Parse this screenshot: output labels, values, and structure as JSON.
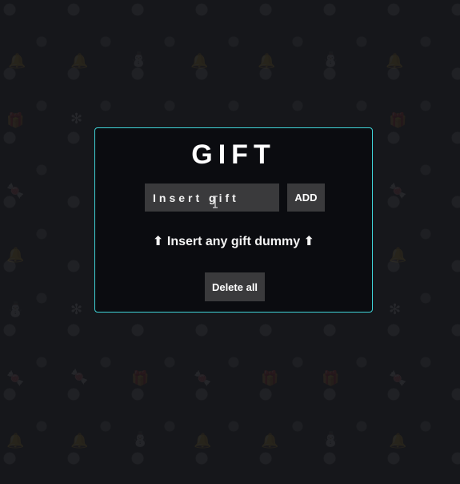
{
  "app": {
    "title": "GIFT"
  },
  "form": {
    "input_placeholder": "Insert gift",
    "input_value": "",
    "add_label": "ADD"
  },
  "message": {
    "hint": "⬆ Insert any gift dummy ⬆"
  },
  "actions": {
    "delete_all_label": "Delete all"
  },
  "background": {
    "icons": [
      "gift-icon",
      "candy-cane-icon",
      "bell-icon",
      "snowman-icon",
      "holly-icon"
    ]
  },
  "colors": {
    "page_background": "#16171b",
    "card_background": "#0b0c10",
    "card_border": "#3fd4d8",
    "control_background": "#3a3a3c",
    "text": "#ffffff"
  }
}
